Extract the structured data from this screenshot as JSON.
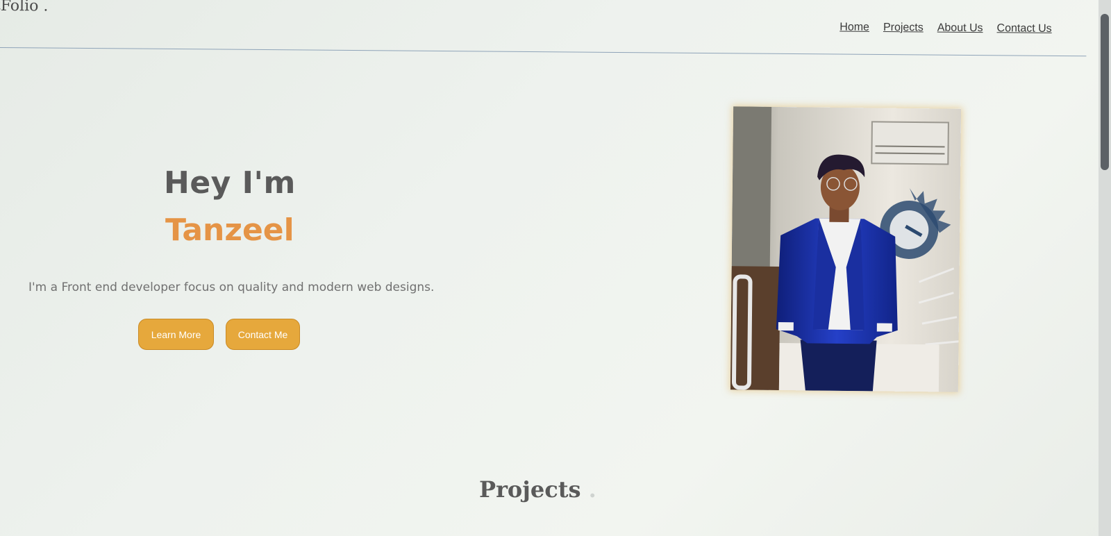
{
  "header": {
    "logo": "tFolio .",
    "nav": [
      "Home",
      "Projects",
      "About Us",
      "Contact Us"
    ]
  },
  "hero": {
    "greeting": "Hey I'm",
    "name": "Tanzeel",
    "tagline": "I'm a Front end developer focus on quality and modern web designs.",
    "buttons": {
      "learn_more": "Learn More",
      "contact_me": "Contact Me"
    }
  },
  "projects_section": {
    "title": "Projects",
    "dot": "."
  },
  "colors": {
    "accent": "#e59446",
    "button": "#e6a83c",
    "text": "#5a5a5a"
  }
}
